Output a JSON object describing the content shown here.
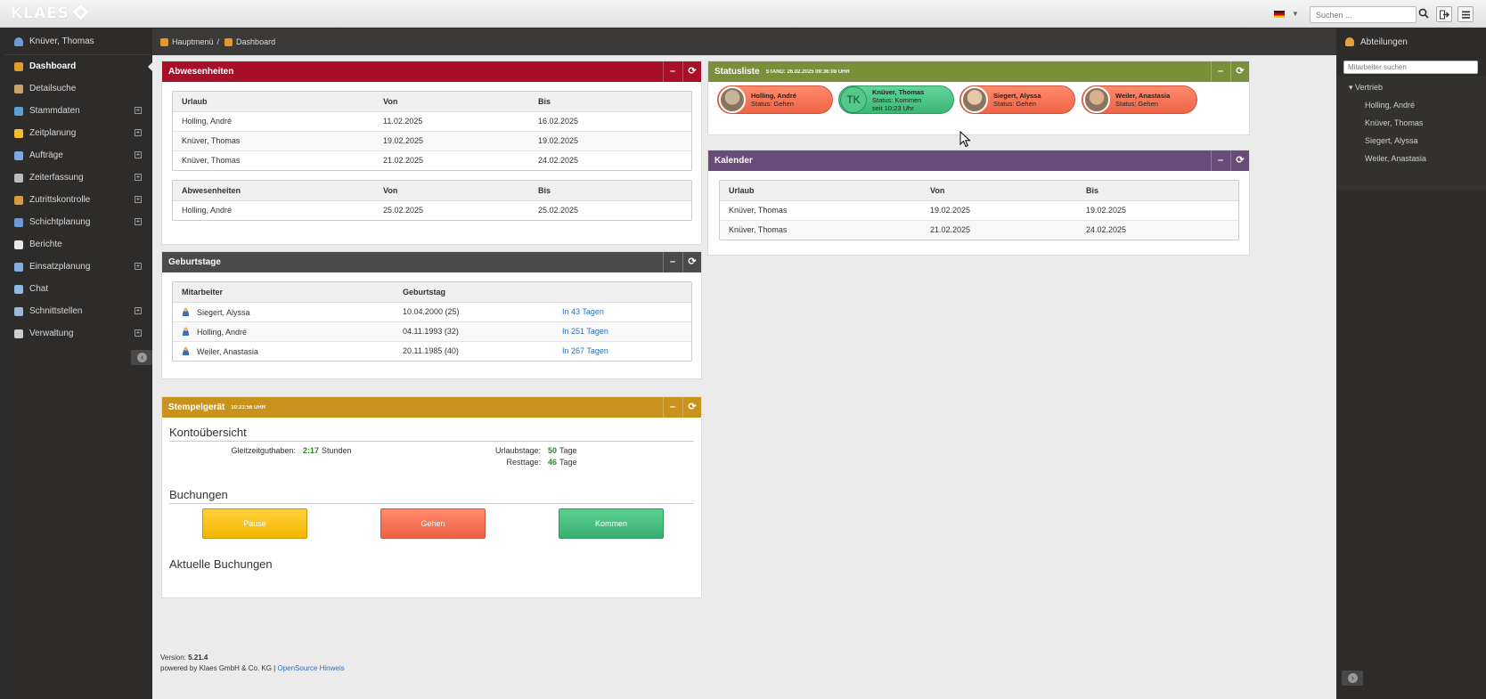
{
  "topbar": {
    "logo": "KLAES",
    "search_placeholder": "Suchen ..."
  },
  "sidebar": {
    "user": "Knüver, Thomas",
    "items": [
      {
        "label": "Dashboard",
        "icon": "home-icon",
        "color": "#e39a2d"
      },
      {
        "label": "Detailsuche",
        "icon": "search-icon",
        "color": "#c9a06a"
      },
      {
        "label": "Stammdaten",
        "icon": "database-icon",
        "color": "#5aa0d6"
      },
      {
        "label": "Zeitplanung",
        "icon": "sun-icon",
        "color": "#f0c030"
      },
      {
        "label": "Aufträge",
        "icon": "documents-icon",
        "color": "#7fa7e0"
      },
      {
        "label": "Zeiterfassung",
        "icon": "clock-icon",
        "color": "#bbbbbb"
      },
      {
        "label": "Zutrittskontrolle",
        "icon": "door-icon",
        "color": "#d89a3a"
      },
      {
        "label": "Schichtplanung",
        "icon": "calendar-icon",
        "color": "#6a9ad8"
      },
      {
        "label": "Berichte",
        "icon": "report-icon",
        "color": "#e8e8e8"
      },
      {
        "label": "Einsatzplanung",
        "icon": "chart-icon",
        "color": "#7fb0e0"
      },
      {
        "label": "Chat",
        "icon": "chat-icon",
        "color": "#8ab8e8"
      },
      {
        "label": "Schnittstellen",
        "icon": "plug-icon",
        "color": "#9ab8d8"
      },
      {
        "label": "Verwaltung",
        "icon": "gear-icon",
        "color": "#cccccc"
      }
    ]
  },
  "breadcrumb": {
    "home": "Hauptmenü",
    "sep": "/",
    "current": "Dashboard"
  },
  "abwesenheiten": {
    "title": "Abwesenheiten",
    "color": "#a8102a",
    "table1": {
      "headers": [
        "Urlaub",
        "Von",
        "Bis"
      ],
      "rows": [
        [
          "Holling, André",
          "11.02.2025",
          "16.02.2025"
        ],
        [
          "Knüver, Thomas",
          "19.02.2025",
          "19.02.2025"
        ],
        [
          "Knüver, Thomas",
          "21.02.2025",
          "24.02.2025"
        ]
      ]
    },
    "table2": {
      "headers": [
        "Abwesenheiten",
        "Von",
        "Bis"
      ],
      "rows": [
        [
          "Holling, André",
          "25.02.2025",
          "25.02.2025"
        ]
      ]
    }
  },
  "geburtstage": {
    "title": "Geburtstage",
    "color": "#4a4a4a",
    "headers": [
      "Mitarbeiter",
      "Geburtstag",
      ""
    ],
    "rows": [
      [
        "Siegert, Alyssa",
        "10.04.2000 (25)",
        "In 43 Tagen"
      ],
      [
        "Holling, André",
        "04.11.1993 (32)",
        "In 251 Tagen"
      ],
      [
        "Weiler, Anastasia",
        "20.11.1985 (40)",
        "In 267 Tagen"
      ]
    ]
  },
  "stempel": {
    "title": "Stempelgerät",
    "time": "10:23:56 UHR",
    "color": "#c9921c",
    "konto_title": "Kontoübersicht",
    "gleitzeit_label": "Gleitzeitguthaben:",
    "gleitzeit_value": "2:17",
    "gleitzeit_unit": "Stunden",
    "urlaub_label": "Urlaubstage:",
    "urlaub_value": "50",
    "urlaub_unit": "Tage",
    "rest_label": "Resttage:",
    "rest_value": "46",
    "rest_unit": "Tage",
    "buchungen_title": "Buchungen",
    "btn_pause": "Pause",
    "btn_gehen": "Gehen",
    "btn_kommen": "Kommen",
    "aktuelle_title": "Aktuelle Buchungen"
  },
  "statusliste": {
    "title": "Statusliste",
    "stand": "STAND: 26.02.2025 09:36:08 UHR",
    "color": "#7a8f3a",
    "people": [
      {
        "name": "Holling, André",
        "status": "Status: Gehen",
        "extra": "",
        "state": "away"
      },
      {
        "name": "Knüver, Thomas",
        "status": "Status: Kommen",
        "extra": "seit 10:23 Uhr",
        "state": "here",
        "initials": "TK"
      },
      {
        "name": "Siegert, Alyssa",
        "status": "Status: Gehen",
        "extra": "",
        "state": "away"
      },
      {
        "name": "Weiler, Anastasia",
        "status": "Status: Gehen",
        "extra": "",
        "state": "away"
      }
    ]
  },
  "kalender": {
    "title": "Kalender",
    "color": "#6a4c7a",
    "headers": [
      "Urlaub",
      "Von",
      "Bis"
    ],
    "rows": [
      [
        "Knüver, Thomas",
        "19.02.2025",
        "19.02.2025"
      ],
      [
        "Knüver, Thomas",
        "21.02.2025",
        "24.02.2025"
      ]
    ]
  },
  "footer": {
    "version_label": "Version:",
    "version": "5.21.4",
    "powered": "powered by Klaes GmbH & Co. KG |",
    "link": "OpenSource Hinweis"
  },
  "right": {
    "title": "Abteilungen",
    "search_placeholder": "Mitarbeiter suchen",
    "group": "Vertrieb",
    "members": [
      "Holling, André",
      "Knüver, Thomas",
      "Siegert, Alyssa",
      "Weiler, Anastasia"
    ]
  }
}
